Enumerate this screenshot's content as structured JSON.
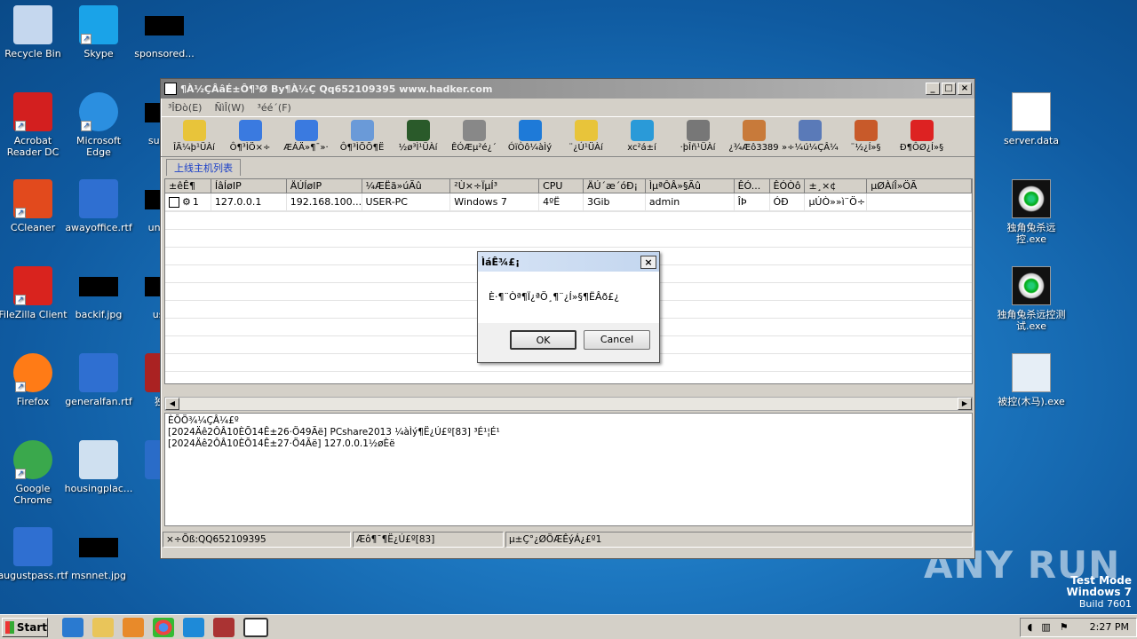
{
  "desktop_left": [
    {
      "label": "Recycle Bin",
      "x": "recycle"
    },
    {
      "label": "Skype"
    },
    {
      "label": "sponsored..."
    },
    {
      "label": "Acrobat Reader DC"
    },
    {
      "label": "Microsoft Edge"
    },
    {
      "label": "supply"
    },
    {
      "label": "CCleaner"
    },
    {
      "label": "awayoffice.rtf"
    },
    {
      "label": "unionc"
    },
    {
      "label": "FileZilla Client"
    },
    {
      "label": "backif.jpg"
    },
    {
      "label": "usbe"
    },
    {
      "label": "Firefox"
    },
    {
      "label": "generalfan.rtf"
    },
    {
      "label": "独角"
    },
    {
      "label": "Google Chrome"
    },
    {
      "label": "housingplac..."
    },
    {
      "label": "L"
    },
    {
      "label": "augustpass.rtf"
    },
    {
      "label": "msnnet.jpg"
    }
  ],
  "desktop_right": [
    {
      "label": "server.data"
    },
    {
      "label": "独角兔杀远控.exe"
    },
    {
      "label": "独角兔杀远控测试.exe"
    },
    {
      "label": "被控(木马).exe"
    }
  ],
  "window": {
    "title": "¶À½ÇÂâÉ±Ô¶³Ø By¶À½Ç Qq652109395 www.hadker.com",
    "menu": [
      "³ÎÐò(E)",
      "ÑìÎ(W)",
      "³éé´(F)"
    ],
    "toolbar": [
      "ÎÄ¼þ¹ÜÀí",
      "Ô¶³ÌÖ×÷",
      "ÆÁÄ»¶¯»·",
      "Ô¶³ÌÕÕ¶Ë",
      "½ø³Ì¹ÜÀí",
      "ÊÓÆµ²é¿´",
      "ÓïÒô¼àÌý",
      "¨¿Ú¹ÜÀí",
      "xc²á±í",
      "·þÎñ¹ÜÀí",
      "¿¾Æô3389",
      "»÷¼ú¼ÇÂ¼",
      "¨½¿Í»§",
      "Ð¶ÔØ¿Í»§"
    ],
    "tab": "上线主机列表",
    "columns": [
      "±êÊ¶",
      "ÍâÍøIP",
      "ÄÚÍøIP",
      "¼ÆËã»úÃû",
      "²Ù×÷ÏµÍ³",
      "CPU",
      "ÄÚ´æ´óÐ¡",
      "ÌµªÔÂ»§Ãû",
      "ÊÓ...",
      "ÊÓÒô",
      "±¸×¢",
      "µØÀíÎ»ÖÃ"
    ],
    "row": [
      "1",
      "127.0.0.1",
      "192.168.100....",
      "USER-PC",
      "Windows 7",
      "4ºË",
      "3Gib",
      "admin",
      "ÎÞ",
      "ÓÐ",
      "µÚÒ»»ì¨Ö÷...",
      ""
    ],
    "log": [
      "ÈÕÖ¾¼ÇÂ¼£º",
      "[2024Äê2ÔÂ10ÈÕ14Ê±26·Ö49Ãë]  PCshare2013  ¼àÌý¶Ë¿Ú£º[83] ³É¹¦É¹",
      "[2024Äê2ÔÂ10ÈÕ14Ê±27·Ö4Ãë]  127.0.0.1½øÈë"
    ],
    "status": [
      "×÷Õß:QQ652109395",
      "Æô¶¯¶Ë¿Ú£º[83]",
      "µ±Ç°¿ØÖÆÊýÁ¿£º1"
    ]
  },
  "dialog": {
    "title": "ÌáÊ¾£¡",
    "message": "È·¶¨Òª¶Ï¿ªÖ¸¶¨¿Í»§¶ËÂð£¿",
    "ok": "OK",
    "cancel": "Cancel"
  },
  "taskbar": {
    "start": "Start",
    "time": "2:27 PM"
  },
  "watermark": {
    "line1": "Test Mode",
    "line2": "Windows 7",
    "line3": "Build 7601",
    "brand": "ANY RUN"
  }
}
